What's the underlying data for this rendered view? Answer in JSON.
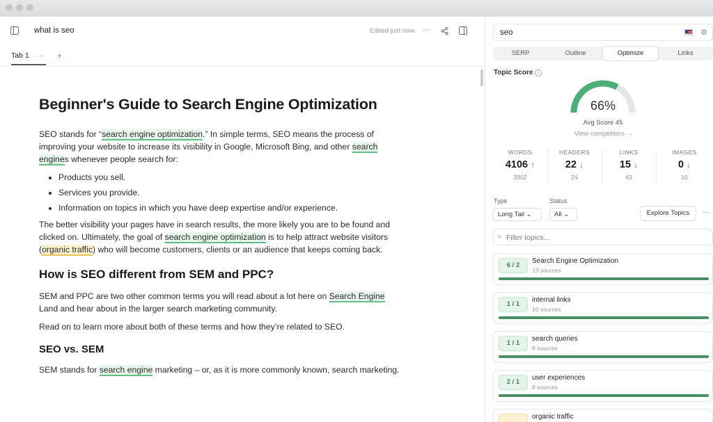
{
  "document": {
    "title": "what is seo",
    "edited_status": "Edited just now",
    "tab_label": "Tab 1",
    "h1": "Beginner's Guide to Search Engine Optimization",
    "p1_a": "SEO stands for “",
    "p1_hl1": "search engine optimization",
    "p1_b": ".” In simple terms, SEO means the process of improving your website to increase its visibility in Google, Microsoft Bing, and other ",
    "p1_hl2": "search engine",
    "p1_c": "s whenever people search for:",
    "list": [
      "Products you sell.",
      "Services you provide.",
      "Information on topics in which you have deep expertise and/or experience."
    ],
    "p2_a": "The better visibility your pages have in search results, the more likely you are to be found and clicked on. Ultimately, the goal of ",
    "p2_hl1": "search engine optimization",
    "p2_b": " is to help attract website visitors (",
    "p2_hl2": "organic traffic",
    "p2_c": ") who will become customers, clients or an audience that keeps coming back.",
    "h2": "How is SEO different from SEM and PPC?",
    "p3_a": "SEM and PPC are two other common terms you will read about a lot here on ",
    "p3_hl": "Search Engine",
    "p3_b": " Land and hear about in the larger search marketing community.",
    "p4": "Read on to learn more about both of these terms and how they’re related to SEO.",
    "h3": "SEO vs. SEM",
    "p5_a": "SEM stands for ",
    "p5_hl": "search engine",
    "p5_b": " marketing – or, as it is more commonly known, search marketing."
  },
  "panel": {
    "keyword": "seo",
    "tabs": [
      "SERP",
      "Outline",
      "Optimize",
      "Links"
    ],
    "active_tab": "Optimize",
    "topic_score_label": "Topic Score",
    "score": "66%",
    "score_value": 66,
    "avg_score": "Avg Score 45",
    "view_competitors": "View competitors →",
    "stats": [
      {
        "label": "WORDS",
        "value": "4106",
        "trend": "↑",
        "dir": "up",
        "sub": "3302"
      },
      {
        "label": "HEADERS",
        "value": "22",
        "trend": "↓",
        "dir": "down",
        "sub": "24"
      },
      {
        "label": "LINKS",
        "value": "15",
        "trend": "↓",
        "dir": "down",
        "sub": "43"
      },
      {
        "label": "IMAGES",
        "value": "0",
        "trend": "↓",
        "dir": "down",
        "sub": "10"
      }
    ],
    "type_label": "Type",
    "type_value": "Long Tail",
    "status_label": "Status",
    "status_value": "All",
    "explore_label": "Explore Topics",
    "more_label": "···",
    "filter_placeholder": "Filter topics...",
    "topics": [
      {
        "badge": "6 / 2",
        "name": "Search Engine Optimization",
        "sources": "13 sources",
        "progress": 1.0,
        "color": "green"
      },
      {
        "badge": "1 / 1",
        "name": "internal links",
        "sources": "10 sources",
        "progress": 1.0,
        "color": "green"
      },
      {
        "badge": "1 / 1",
        "name": "search queries",
        "sources": "8 sources",
        "progress": 1.0,
        "color": "green"
      },
      {
        "badge": "2 / 1",
        "name": "user experiences",
        "sources": "8 sources",
        "progress": 1.0,
        "color": "green"
      },
      {
        "badge": "",
        "name": "organic traffic",
        "sources": "",
        "progress": 1.0,
        "color": "yellow"
      }
    ]
  },
  "colors": {
    "accent_green": "#4a8f62",
    "gauge_green": "#4caf7a",
    "down_red": "#d24848",
    "highlight_green": "#e7f6ec",
    "highlight_yellow": "#fff3cf"
  }
}
